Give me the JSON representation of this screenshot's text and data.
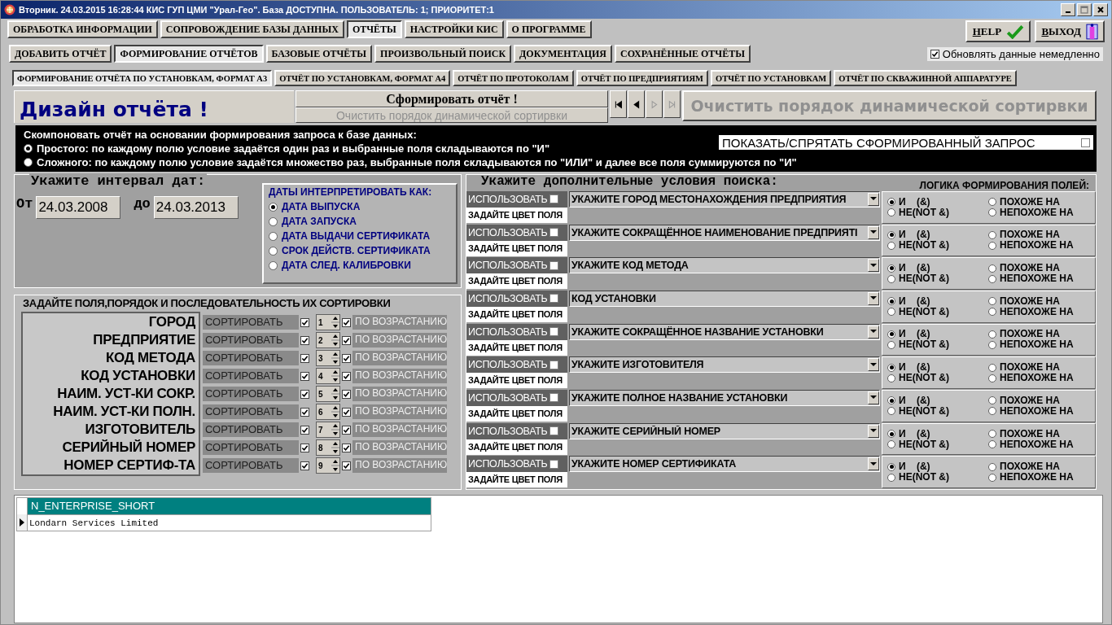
{
  "window": {
    "title": "Вторник. 24.03.2015 16:28:44 КИС ГУП ЦМИ \"Урал-Гео\". База ДОСТУПНА. ПОЛЬЗОВАТЕЛЬ: 1; ПРИОРИТЕТ:1"
  },
  "menu_tabs": [
    {
      "label": "ОБРАБОТКА ИНФОРМАЦИИ",
      "selected": false
    },
    {
      "label": "СОПРОВОЖДЕНИЕ БАЗЫ ДАННЫХ",
      "selected": false
    },
    {
      "label": "ОТЧЁТЫ",
      "selected": true
    },
    {
      "label": "НАСТРОЙКИ КИС",
      "selected": false
    },
    {
      "label": "О ПРОГРАММЕ",
      "selected": false
    }
  ],
  "help_button": {
    "label": "HELP"
  },
  "exit_button": {
    "label": "ВЫХОД"
  },
  "sub_tabs": [
    {
      "label": "ДОБАВИТЬ ОТЧЁТ",
      "selected": false
    },
    {
      "label": "ФОРМИРОВАНИЕ ОТЧЁТОВ",
      "selected": true
    },
    {
      "label": "БАЗОВЫЕ ОТЧЁТЫ",
      "selected": false
    },
    {
      "label": "ПРОИЗВОЛЬНЫЙ ПОИСК",
      "selected": false
    },
    {
      "label": "ДОКУМЕНТАЦИЯ",
      "selected": false
    },
    {
      "label": "СОХРАНЁННЫЕ ОТЧЁТЫ",
      "selected": false
    }
  ],
  "auto_update": {
    "label": "Обновлять данные немедленно",
    "checked": true
  },
  "report_tabs": [
    {
      "label": "ФОРМИРОВАНИЕ ОТЧЁТА ПО УСТАНОВКАМ, ФОРМАТ А3",
      "selected": true
    },
    {
      "label": "ОТЧЁТ ПО УСТАНОВКАМ, ФОРМАТ А4",
      "selected": false
    },
    {
      "label": "ОТЧЁТ ПО ПРОТОКОЛАМ",
      "selected": false
    },
    {
      "label": "ОТЧЁТ ПО ПРЕДПРИЯТИЯМ",
      "selected": false
    },
    {
      "label": "ОТЧЁТ ПО УСТАНОВКАМ",
      "selected": false
    },
    {
      "label": "ОТЧЁТ ПО СКВАЖИННОЙ АППАРАТУРЕ",
      "selected": false
    }
  ],
  "design": {
    "title": "Дизайн отчёта !",
    "generate_button": {
      "label": "Сформировать отчёт !",
      "disabled": false
    },
    "clear_button": {
      "label": "Очистить порядок динамической сортирвки",
      "disabled": true
    },
    "nav_buttons": [
      {
        "kind": "first",
        "disabled": false
      },
      {
        "kind": "prev",
        "disabled": false
      },
      {
        "kind": "next",
        "disabled": true
      },
      {
        "kind": "last",
        "disabled": true
      }
    ],
    "big_clear_button": {
      "label": "Очистить порядок динамической сортирвки",
      "disabled": true
    }
  },
  "query_mode": {
    "legend": "Скомпоновать отчёт на основании формирования запроса к базе данных:",
    "options": [
      {
        "label": "Простого: по каждому полю условие задаётся один раз и выбранные поля складываются по \"И\"",
        "selected": true
      },
      {
        "label": "Сложного: по каждому полю условие задаётся множество раз, выбранные поля складываются по \"ИЛИ\" и далее все поля суммируются по \"И\"",
        "selected": false
      }
    ],
    "show_query": {
      "label": "ПОКАЗАТЬ/СПРЯТАТЬ СФОРМИРОВАННЫЙ ЗАПРОС",
      "checked": false
    }
  },
  "date_interval": {
    "legend": "Укажите интервал дат:",
    "from_label": "От",
    "from": "24.03.2008",
    "to_label": "до",
    "to": "24.03.2013",
    "interpret_legend": "ДАТЫ ИНТЕРПРЕТИРОВАТЬ КАК:",
    "interpret_options": [
      {
        "label": "ДАТА ВЫПУСКА",
        "selected": true
      },
      {
        "label": "ДАТА ЗАПУСКА",
        "selected": false
      },
      {
        "label": "ДАТА ВЫДАЧИ  СЕРТИФИКАТА",
        "selected": false
      },
      {
        "label": "СРОК ДЕЙСТВ. СЕРТИФИКАТА",
        "selected": false
      },
      {
        "label": "ДАТА СЛЕД. КАЛИБРОВКИ",
        "selected": false
      }
    ]
  },
  "sort": {
    "legend": "ЗАДАЙТЕ ПОЛЯ,ПОРЯДОК И ПОСЛЕДОВАТЕЛЬНОСТЬ ИХ СОРТИРОВКИ",
    "fields": [
      {
        "name": "ГОРОД",
        "sort_label": "СОРТИРОВАТЬ",
        "sort_checked": true,
        "order": "1",
        "asc_label": "ПО ВОЗРАСТАНИЮ",
        "asc_checked": true
      },
      {
        "name": "ПРЕДПРИЯТИЕ",
        "sort_label": "СОРТИРОВАТЬ",
        "sort_checked": true,
        "order": "2",
        "asc_label": "ПО ВОЗРАСТАНИЮ",
        "asc_checked": true
      },
      {
        "name": "КОД МЕТОДА",
        "sort_label": "СОРТИРОВАТЬ",
        "sort_checked": true,
        "order": "3",
        "asc_label": "ПО ВОЗРАСТАНИЮ",
        "asc_checked": true
      },
      {
        "name": "КОД УСТАНОВКИ",
        "sort_label": "СОРТИРОВАТЬ",
        "sort_checked": true,
        "order": "4",
        "asc_label": "ПО ВОЗРАСТАНИЮ",
        "asc_checked": true
      },
      {
        "name": "НАИМ. УСТ-КИ СОКР.",
        "sort_label": "СОРТИРОВАТЬ",
        "sort_checked": true,
        "order": "5",
        "asc_label": "ПО ВОЗРАСТАНИЮ",
        "asc_checked": true
      },
      {
        "name": "НАИМ. УСТ-КИ ПОЛН.",
        "sort_label": "СОРТИРОВАТЬ",
        "sort_checked": true,
        "order": "6",
        "asc_label": "ПО ВОЗРАСТАНИЮ",
        "asc_checked": true
      },
      {
        "name": "ИЗГОТОВИТЕЛЬ",
        "sort_label": "СОРТИРОВАТЬ",
        "sort_checked": true,
        "order": "7",
        "asc_label": "ПО ВОЗРАСТАНИЮ",
        "asc_checked": true
      },
      {
        "name": "СЕРИЙНЫЙ НОМЕР",
        "sort_label": "СОРТИРОВАТЬ",
        "sort_checked": true,
        "order": "8",
        "asc_label": "ПО ВОЗРАСТАНИЮ",
        "asc_checked": true
      },
      {
        "name": "НОМЕР СЕРТИФ-ТА",
        "sort_label": "СОРТИРОВАТЬ",
        "sort_checked": true,
        "order": "9",
        "asc_label": "ПО ВОЗРАСТАНИЮ",
        "asc_checked": true
      }
    ]
  },
  "conditions": {
    "legend": "Укажите дополнительные условия поиска:",
    "logic_legend": "ЛОГИКА ФОРМИРОВАНИЯ ПОЛЕЙ:",
    "rows": [
      {
        "use_label": "ИСПОЛЬЗОВАТЬ",
        "use_checked": false,
        "color_label": "ЗАДАЙТЕ ЦВЕТ ПОЛЯ",
        "value": "УКАЖИТЕ ГОРОД МЕСТОНАХОЖДЕНИЯ ПРЕДПРИЯТИЯ",
        "logic": [
          {
            "label": "И    (&)",
            "selected": true
          },
          {
            "label": "ПОХОЖЕ НА",
            "selected": false
          },
          {
            "label": "НЕ(NOT &)",
            "selected": false
          },
          {
            "label": "НЕПОХОЖЕ НА",
            "selected": false
          }
        ]
      },
      {
        "use_label": "ИСПОЛЬЗОВАТЬ",
        "use_checked": false,
        "color_label": "ЗАДАЙТЕ ЦВЕТ ПОЛЯ",
        "value": "УКАЖИТЕ СОКРАЩЁННОЕ НАИМЕНОВАНИЕ ПРЕДПРИЯТІ",
        "logic": [
          {
            "label": "И    (&)",
            "selected": true
          },
          {
            "label": "ПОХОЖЕ НА",
            "selected": false
          },
          {
            "label": "НЕ(NOT &)",
            "selected": false
          },
          {
            "label": "НЕПОХОЖЕ НА",
            "selected": false
          }
        ]
      },
      {
        "use_label": "ИСПОЛЬЗОВАТЬ",
        "use_checked": false,
        "color_label": "ЗАДАЙТЕ ЦВЕТ ПОЛЯ",
        "value": "УКАЖИТЕ КОД МЕТОДА",
        "logic": [
          {
            "label": "И    (&)",
            "selected": true
          },
          {
            "label": "ПОХОЖЕ НА",
            "selected": false
          },
          {
            "label": "НЕ(NOT &)",
            "selected": false
          },
          {
            "label": "НЕПОХОЖЕ НА",
            "selected": false
          }
        ]
      },
      {
        "use_label": "ИСПОЛЬЗОВАТЬ",
        "use_checked": false,
        "color_label": "ЗАДАЙТЕ ЦВЕТ ПОЛЯ",
        "value": "КОД УСТАНОВКИ",
        "logic": [
          {
            "label": "И    (&)",
            "selected": true
          },
          {
            "label": "ПОХОЖЕ НА",
            "selected": false
          },
          {
            "label": "НЕ(NOT &)",
            "selected": false
          },
          {
            "label": "НЕПОХОЖЕ НА",
            "selected": false
          }
        ]
      },
      {
        "use_label": "ИСПОЛЬЗОВАТЬ",
        "use_checked": false,
        "color_label": "ЗАДАЙТЕ ЦВЕТ ПОЛЯ",
        "value": "УКАЖИТЕ СОКРАЩЁННОЕ НАЗВАНИЕ УСТАНОВКИ",
        "logic": [
          {
            "label": "И    (&)",
            "selected": true
          },
          {
            "label": "ПОХОЖЕ НА",
            "selected": false
          },
          {
            "label": "НЕ(NOT &)",
            "selected": false
          },
          {
            "label": "НЕПОХОЖЕ НА",
            "selected": false
          }
        ]
      },
      {
        "use_label": "ИСПОЛЬЗОВАТЬ",
        "use_checked": false,
        "color_label": "ЗАДАЙТЕ ЦВЕТ ПОЛЯ",
        "value": "УКАЖИТЕ ИЗГОТОВИТЕЛЯ",
        "logic": [
          {
            "label": "И    (&)",
            "selected": true
          },
          {
            "label": "ПОХОЖЕ НА",
            "selected": false
          },
          {
            "label": "НЕ(NOT &)",
            "selected": false
          },
          {
            "label": "НЕПОХОЖЕ НА",
            "selected": false
          }
        ]
      },
      {
        "use_label": "ИСПОЛЬЗОВАТЬ",
        "use_checked": false,
        "color_label": "ЗАДАЙТЕ ЦВЕТ ПОЛЯ",
        "value": "УКАЖИТЕ ПОЛНОЕ НАЗВАНИЕ УСТАНОВКИ",
        "logic": [
          {
            "label": "И    (&)",
            "selected": true
          },
          {
            "label": "ПОХОЖЕ НА",
            "selected": false
          },
          {
            "label": "НЕ(NOT &)",
            "selected": false
          },
          {
            "label": "НЕПОХОЖЕ НА",
            "selected": false
          }
        ]
      },
      {
        "use_label": "ИСПОЛЬЗОВАТЬ",
        "use_checked": false,
        "color_label": "ЗАДАЙТЕ ЦВЕТ ПОЛЯ",
        "value": "УКАЖИТЕ СЕРИЙНЫЙ НОМЕР",
        "logic": [
          {
            "label": "И    (&)",
            "selected": true
          },
          {
            "label": "ПОХОЖЕ НА",
            "selected": false
          },
          {
            "label": "НЕ(NOT &)",
            "selected": false
          },
          {
            "label": "НЕПОХОЖЕ НА",
            "selected": false
          }
        ]
      },
      {
        "use_label": "ИСПОЛЬЗОВАТЬ",
        "use_checked": false,
        "color_label": "ЗАДАЙТЕ ЦВЕТ ПОЛЯ",
        "value": "УКАЖИТЕ НОМЕР СЕРТИФИКАТА",
        "logic": [
          {
            "label": "И    (&)",
            "selected": true
          },
          {
            "label": "ПОХОЖЕ НА",
            "selected": false
          },
          {
            "label": "НЕ(NOT &)",
            "selected": false
          },
          {
            "label": "НЕПОХОЖЕ НА",
            "selected": false
          }
        ]
      }
    ]
  },
  "results": {
    "columns": [
      "N_ENTERPRISE_SHORT"
    ],
    "rows": [
      {
        "cells": [
          "Londarn Services Limited"
        ],
        "selected": true
      }
    ]
  }
}
